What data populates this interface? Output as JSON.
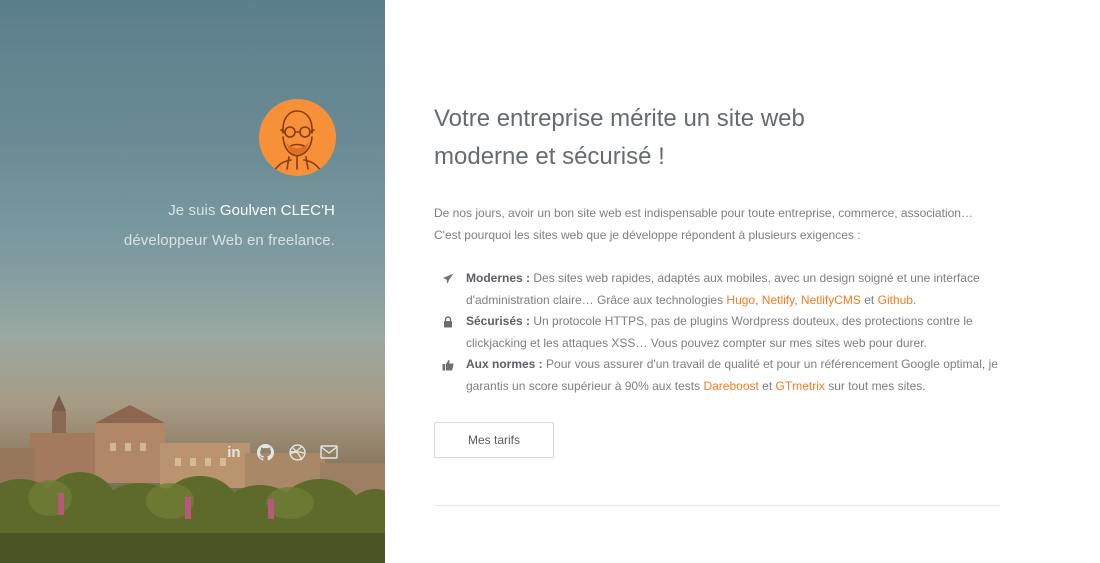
{
  "sidebar": {
    "intro_prefix": "Je suis ",
    "name": "Goulven CLEC'H",
    "role": "développeur Web en freelance.",
    "avatar_icon": "portrait-avatar",
    "socials": [
      {
        "icon": "linkedin-icon",
        "glyph": "in"
      },
      {
        "icon": "github-icon"
      },
      {
        "icon": "dribbble-icon"
      },
      {
        "icon": "mail-icon"
      }
    ]
  },
  "main": {
    "headline_line1": "Votre entreprise mérite un site web",
    "headline_line2": "moderne et sécurisé !",
    "lead": "De nos jours, avoir un bon site web est indispensable pour toute entreprise, commerce, association… C'est pourquoi les sites web que je développe répondent à plusieurs exigences :",
    "features": [
      {
        "icon": "rocket-icon",
        "title": "Modernes :",
        "text": " Des sites web rapides, adaptés aux mobiles, avec un design soigné et une interface d'administration claire… Grâce aux technologies ",
        "links": [
          "Hugo",
          "Netlify",
          "NetlifyCMS",
          "Github"
        ],
        "sep1": ", ",
        "sep2": ", ",
        "sep3": " et ",
        "end": "."
      },
      {
        "icon": "lock-icon",
        "title": "Sécurisés :",
        "text": " Un protocole HTTPS, pas de plugins Wordpress douteux, des protections contre le clickjacking et les attaques XSS… Vous pouvez compter sur mes sites web pour durer."
      },
      {
        "icon": "thumbs-up-icon",
        "title": "Aux normes :",
        "text": " Pour vous assurer d'un travail de qualité et pour un référencement Google optimal, je garantis un score supérieur à 90% aux tests ",
        "links": [
          "Dareboost",
          "GTmetrix"
        ],
        "sep1": " et ",
        "end": " sur tout mes sites."
      }
    ],
    "cta_label": "Mes tarifs"
  },
  "colors": {
    "accent": "#f47b20",
    "avatar_bg": "#f6913a",
    "text": "#7b7f83",
    "heading": "#666b6f"
  }
}
